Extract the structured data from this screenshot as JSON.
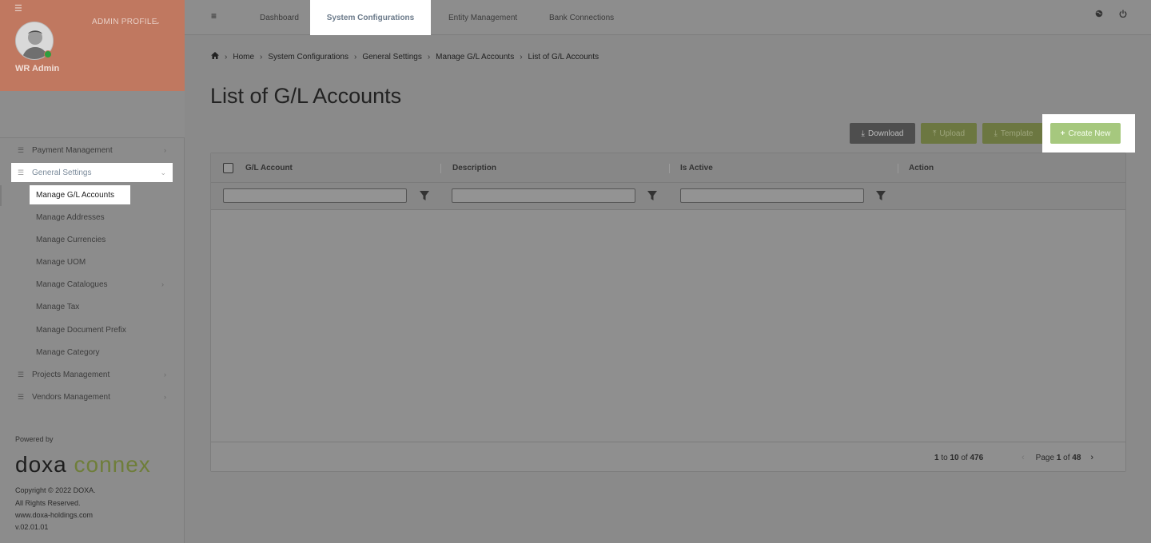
{
  "sidebar": {
    "admin_profile": "ADMIN PROFILE",
    "user_name": "WR Admin",
    "items": [
      {
        "label": "Payment Management"
      },
      {
        "label": "General Settings"
      },
      {
        "label": "Projects Management"
      },
      {
        "label": "Vendors Management"
      }
    ],
    "sub_items": [
      {
        "label": "Manage G/L Accounts"
      },
      {
        "label": "Manage Addresses"
      },
      {
        "label": "Manage Currencies"
      },
      {
        "label": "Manage UOM"
      },
      {
        "label": "Manage Catalogues"
      },
      {
        "label": "Manage Tax"
      },
      {
        "label": "Manage Document Prefix"
      },
      {
        "label": "Manage Category"
      }
    ],
    "powered_by": "Powered by",
    "logo_left": "doxa",
    "logo_right": "connex",
    "copyright": "Copyright © 2022 DOXA.",
    "rights": "All Rights Reserved.",
    "website": "www.doxa-holdings.com",
    "version": "v.02.01.01"
  },
  "topbar": {
    "tabs": [
      {
        "label": "Dashboard"
      },
      {
        "label": "System Configurations"
      },
      {
        "label": "Entity Management"
      },
      {
        "label": "Bank Connections"
      }
    ]
  },
  "breadcrumb": [
    "Home",
    "System Configurations",
    "General Settings",
    "Manage G/L Accounts",
    "List of G/L Accounts"
  ],
  "page_title": "List of G/L Accounts",
  "actions": {
    "download": "Download",
    "upload": "Upload",
    "template": "Template",
    "create": "Create New"
  },
  "grid": {
    "columns": [
      "G/L Account",
      "Description",
      "Is Active",
      "Action"
    ],
    "summary": {
      "from": "1",
      "to_word": "to",
      "to": "10",
      "of_word": "of",
      "total": "476"
    },
    "pager": {
      "page_word": "Page",
      "page": "1",
      "of_word": "of",
      "pages": "48"
    }
  },
  "colors": {
    "sidebar_header": "#c07860",
    "create_button": "#a6c87e",
    "download_button": "#4e4e4e",
    "online_status": "#2e9e3e"
  },
  "icons": [
    "menu-icon",
    "home-icon",
    "globe-icon",
    "power-icon",
    "filter-icon",
    "list-icon",
    "chevron-icon"
  ]
}
